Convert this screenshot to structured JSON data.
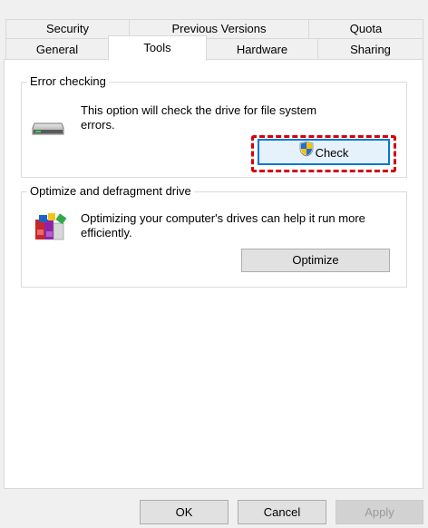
{
  "tabs_row1": [
    {
      "label": "Security"
    },
    {
      "label": "Previous Versions"
    },
    {
      "label": "Quota"
    }
  ],
  "tabs_row2": [
    {
      "label": "General"
    },
    {
      "label": "Tools",
      "active": true
    },
    {
      "label": "Hardware"
    },
    {
      "label": "Sharing"
    }
  ],
  "error_checking": {
    "title": "Error checking",
    "description": "This option will check the drive for file system errors.",
    "button_label": "Check",
    "icon": "drive-icon",
    "button_icon": "uac-shield-icon"
  },
  "optimize": {
    "title": "Optimize and defragment drive",
    "description": "Optimizing your computer's drives can help it run more efficiently.",
    "button_label": "Optimize",
    "icon": "defrag-icon"
  },
  "footer": {
    "ok_label": "OK",
    "cancel_label": "Cancel",
    "apply_label": "Apply"
  },
  "colors": {
    "focus_border": "#0078d7",
    "highlight_dashed": "#d4000a"
  }
}
